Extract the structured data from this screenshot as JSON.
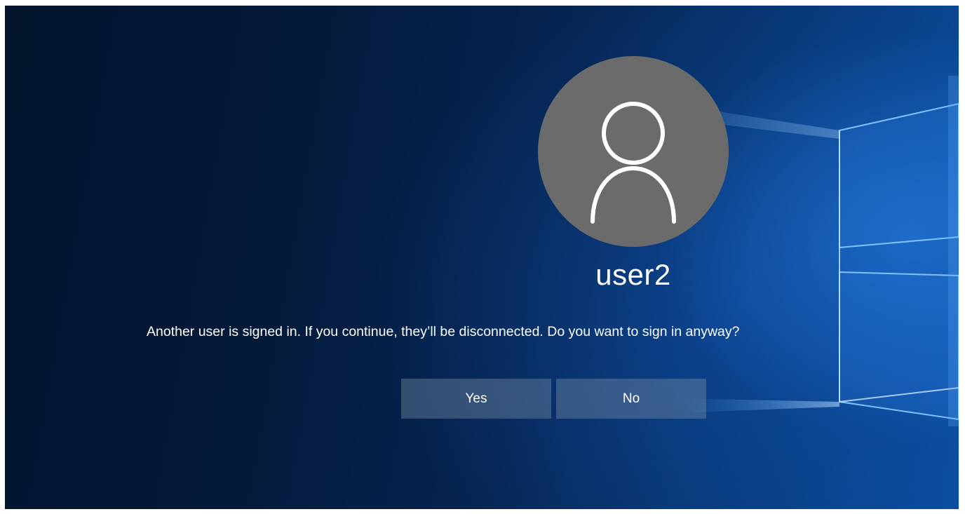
{
  "lock_screen": {
    "user": {
      "avatar_icon": "user-silhouette-icon",
      "name": "user2"
    },
    "prompt": {
      "message": "Another user is signed in. If you continue, they’ll be disconnected. Do you want to sign in anyway?"
    },
    "actions": {
      "yes_label": "Yes",
      "no_label": "No"
    }
  },
  "colors": {
    "avatar_bg": "#6b6b6b",
    "button_bg": "rgba(120,140,165,0.42)",
    "wallpaper_dark": "#03142c",
    "wallpaper_light": "#0b4ea0",
    "light_beam": "#66b3ff"
  }
}
